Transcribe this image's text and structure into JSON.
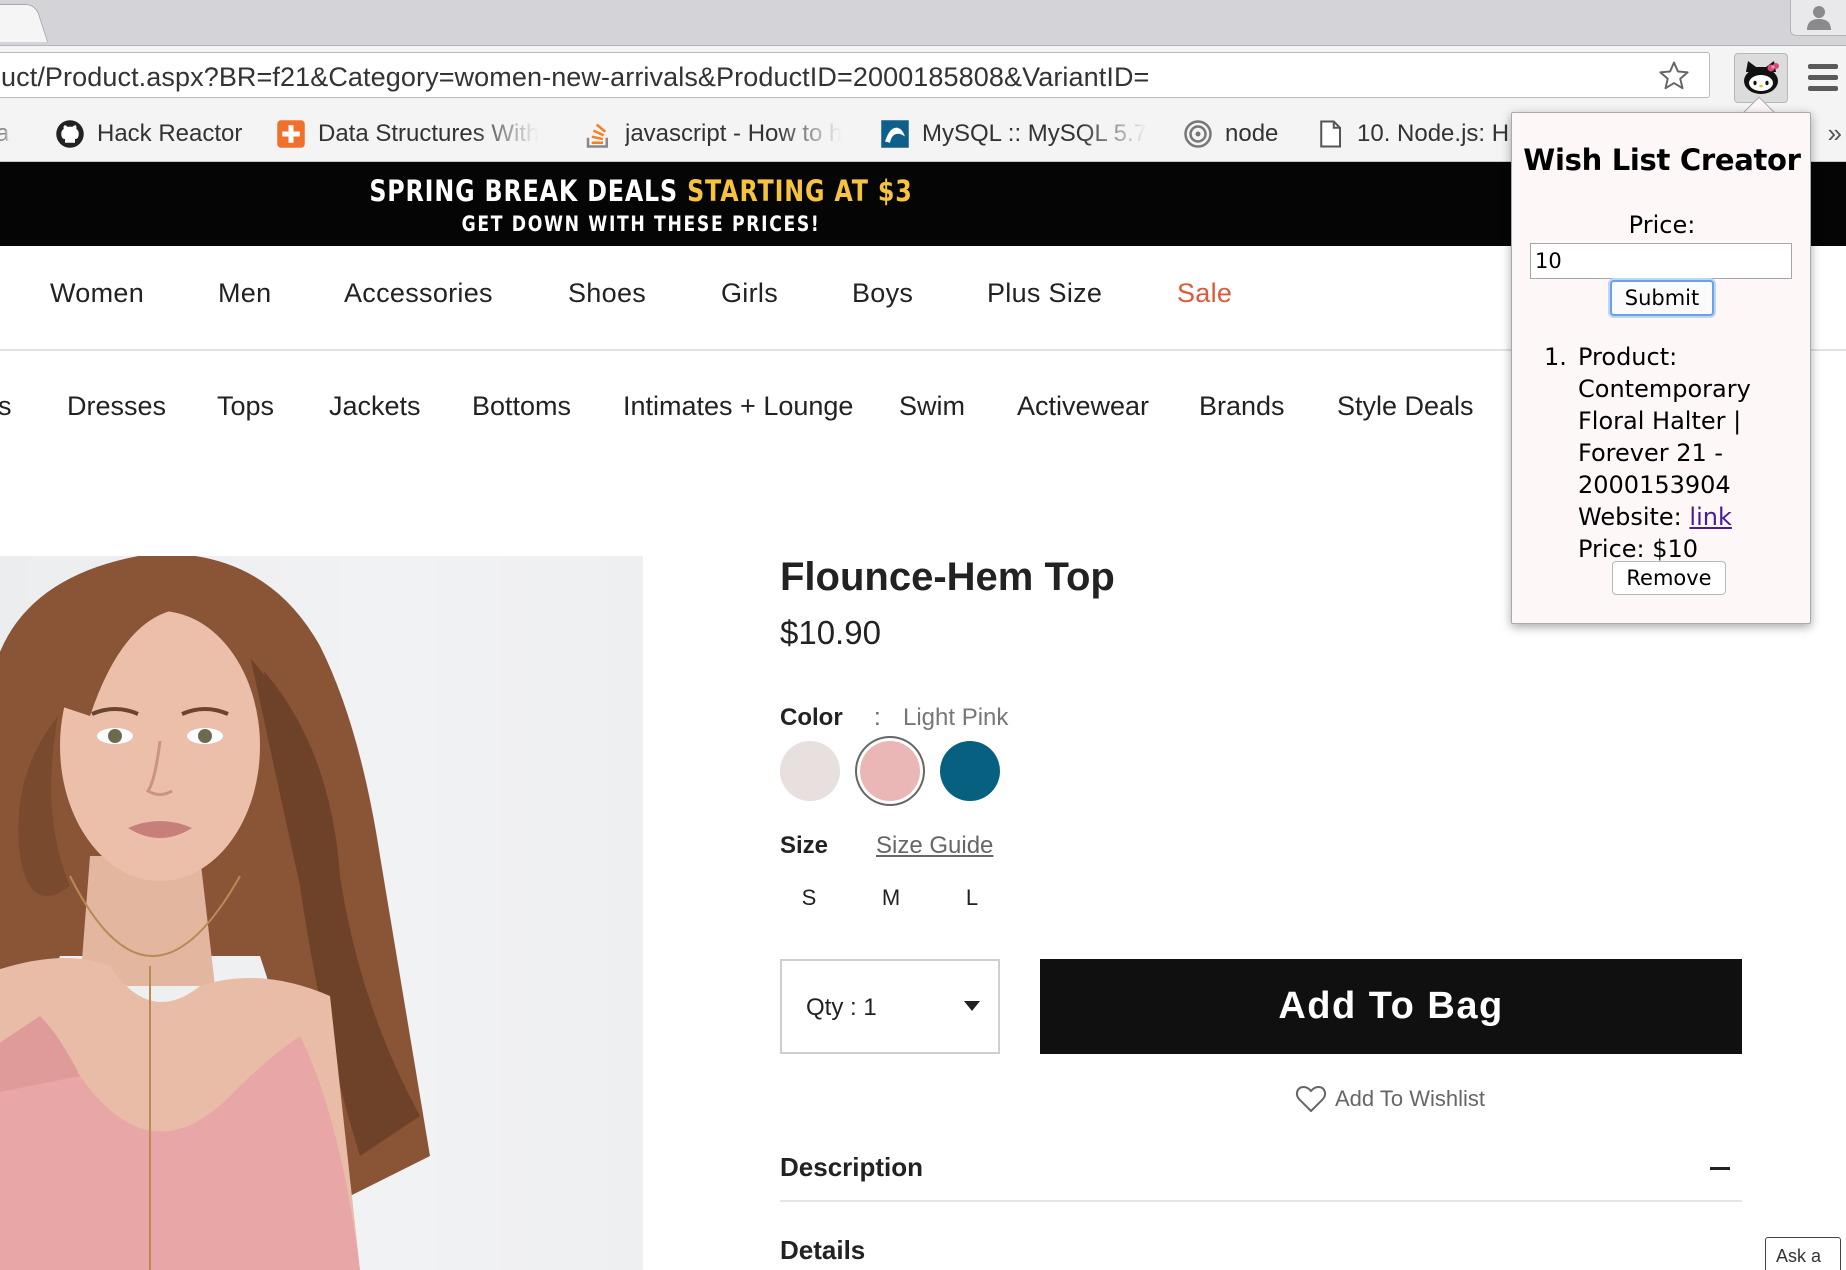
{
  "browser": {
    "url": "uct/Product.aspx?BR=f21&Category=women-new-arrivals&ProductID=2000185808&VariantID=",
    "bookmarks": [
      {
        "label": "a",
        "icon": "page-icon"
      },
      {
        "label": "Hack Reactor",
        "icon": "github-icon"
      },
      {
        "label": "Data Structures With",
        "icon": "plus-square-icon"
      },
      {
        "label": "javascript - How to h",
        "icon": "stackoverflow-icon"
      },
      {
        "label": "MySQL :: MySQL 5.7",
        "icon": "mysql-icon"
      },
      {
        "label": "node",
        "icon": "node-ring-icon"
      },
      {
        "label": "10. Node.js: H",
        "icon": "document-icon"
      }
    ],
    "bookmarks_more": "»"
  },
  "promo": {
    "line1_white": "SPRING BREAK DEALS",
    "line1_yellow": "STARTING AT $3",
    "line2": "GET DOWN WITH THESE PRICES!",
    "accent_color": "#f5c33c"
  },
  "main_nav": [
    "Women",
    "Men",
    "Accessories",
    "Shoes",
    "Girls",
    "Boys",
    "Plus Size",
    "Sale"
  ],
  "sub_nav": [
    "s",
    "Dresses",
    "Tops",
    "Jackets",
    "Bottoms",
    "Intimates + Lounge",
    "Swim",
    "Activewear",
    "Brands",
    "Style Deals"
  ],
  "product": {
    "title": "Flounce-Hem Top",
    "price": "$10.90",
    "color_label": "Color",
    "color_sep": ":",
    "color_value": "Light Pink",
    "swatches": [
      {
        "name": "Cream",
        "hex": "#e8dfdf",
        "selected": false
      },
      {
        "name": "Light Pink",
        "hex": "#ebb6b6",
        "selected": true
      },
      {
        "name": "Teal",
        "hex": "#07607f",
        "selected": false
      }
    ],
    "size_label": "Size",
    "size_guide": "Size Guide",
    "sizes": [
      "S",
      "M",
      "L"
    ],
    "qty_label": "Qty : 1",
    "add_to_bag": "Add To Bag",
    "add_to_wishlist": "Add To Wishlist",
    "description_label": "Description",
    "details_label": "Details",
    "sale_color": "#dd5a3c"
  },
  "chat": {
    "label": "Ask a"
  },
  "popup": {
    "title": "Wish List Creator",
    "price_label": "Price:",
    "price_value": "10",
    "submit_label": "Submit",
    "item_number": "1.",
    "item_product_label": "Product:",
    "item_product_name": "Contemporary Floral Halter | Forever 21 - 2000153904",
    "item_website_label": "Website:",
    "item_website_link": "link",
    "item_price": "Price: $10",
    "remove_label": "Remove"
  }
}
